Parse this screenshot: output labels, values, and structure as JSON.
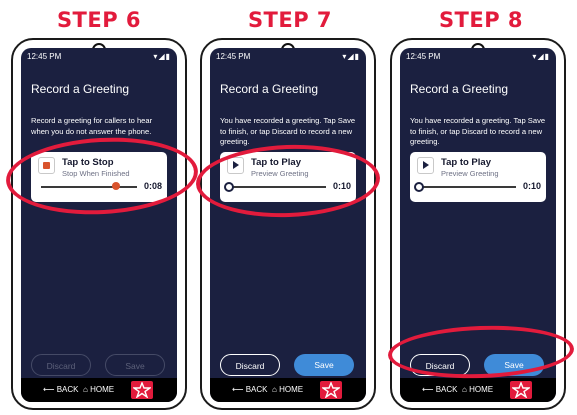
{
  "steps": [
    {
      "step_label": "STEP 6",
      "status": {
        "time": "12:45 PM",
        "icons": "▾◢▮"
      },
      "title": "Record a Greeting",
      "description": "Record a greeting for callers to hear when you do not answer the phone.",
      "card": {
        "title": "Tap to Stop",
        "subtitle": "Stop When Finished",
        "time": "0:08",
        "icon": "stop-icon",
        "progress": 0.88
      },
      "buttons": {
        "discard": "Discard",
        "save": "Save",
        "state": "disabled"
      },
      "nav": {
        "back": "BACK",
        "home": "HOME",
        "logo": "star-logo"
      }
    },
    {
      "step_label": "STEP 7",
      "status": {
        "time": "12:45 PM",
        "icons": "▾◢▮"
      },
      "title": "Record a Greeting",
      "description": "You have recorded a greeting. Tap Save to finish, or tap Discard to record a new greeting.",
      "card": {
        "title": "Tap to Play",
        "subtitle": "Preview Greeting",
        "time": "0:10",
        "icon": "play-icon",
        "progress": 0.0
      },
      "buttons": {
        "discard": "Discard",
        "save": "Save",
        "state": "enabled"
      },
      "nav": {
        "back": "BACK",
        "home": "HOME",
        "logo": "star-logo"
      }
    },
    {
      "step_label": "STEP 8",
      "status": {
        "time": "12:45 PM",
        "icons": "▾◢▮"
      },
      "title": "Record a Greeting",
      "description": "You have recorded a greeting. Tap Save to finish, or tap Discard to record a new greeting.",
      "card": {
        "title": "Tap to Play",
        "subtitle": "Preview Greeting",
        "time": "0:10",
        "icon": "play-icon",
        "progress": 0.0
      },
      "buttons": {
        "discard": "Discard",
        "save": "Save",
        "state": "enabled"
      },
      "nav": {
        "back": "BACK",
        "home": "HOME",
        "logo": "star-logo"
      }
    }
  ],
  "colors": {
    "accent_red": "#e21b3c",
    "screen_bg": "#1b2040",
    "button_blue": "#3f8bd8",
    "record_orange": "#d9532c"
  }
}
